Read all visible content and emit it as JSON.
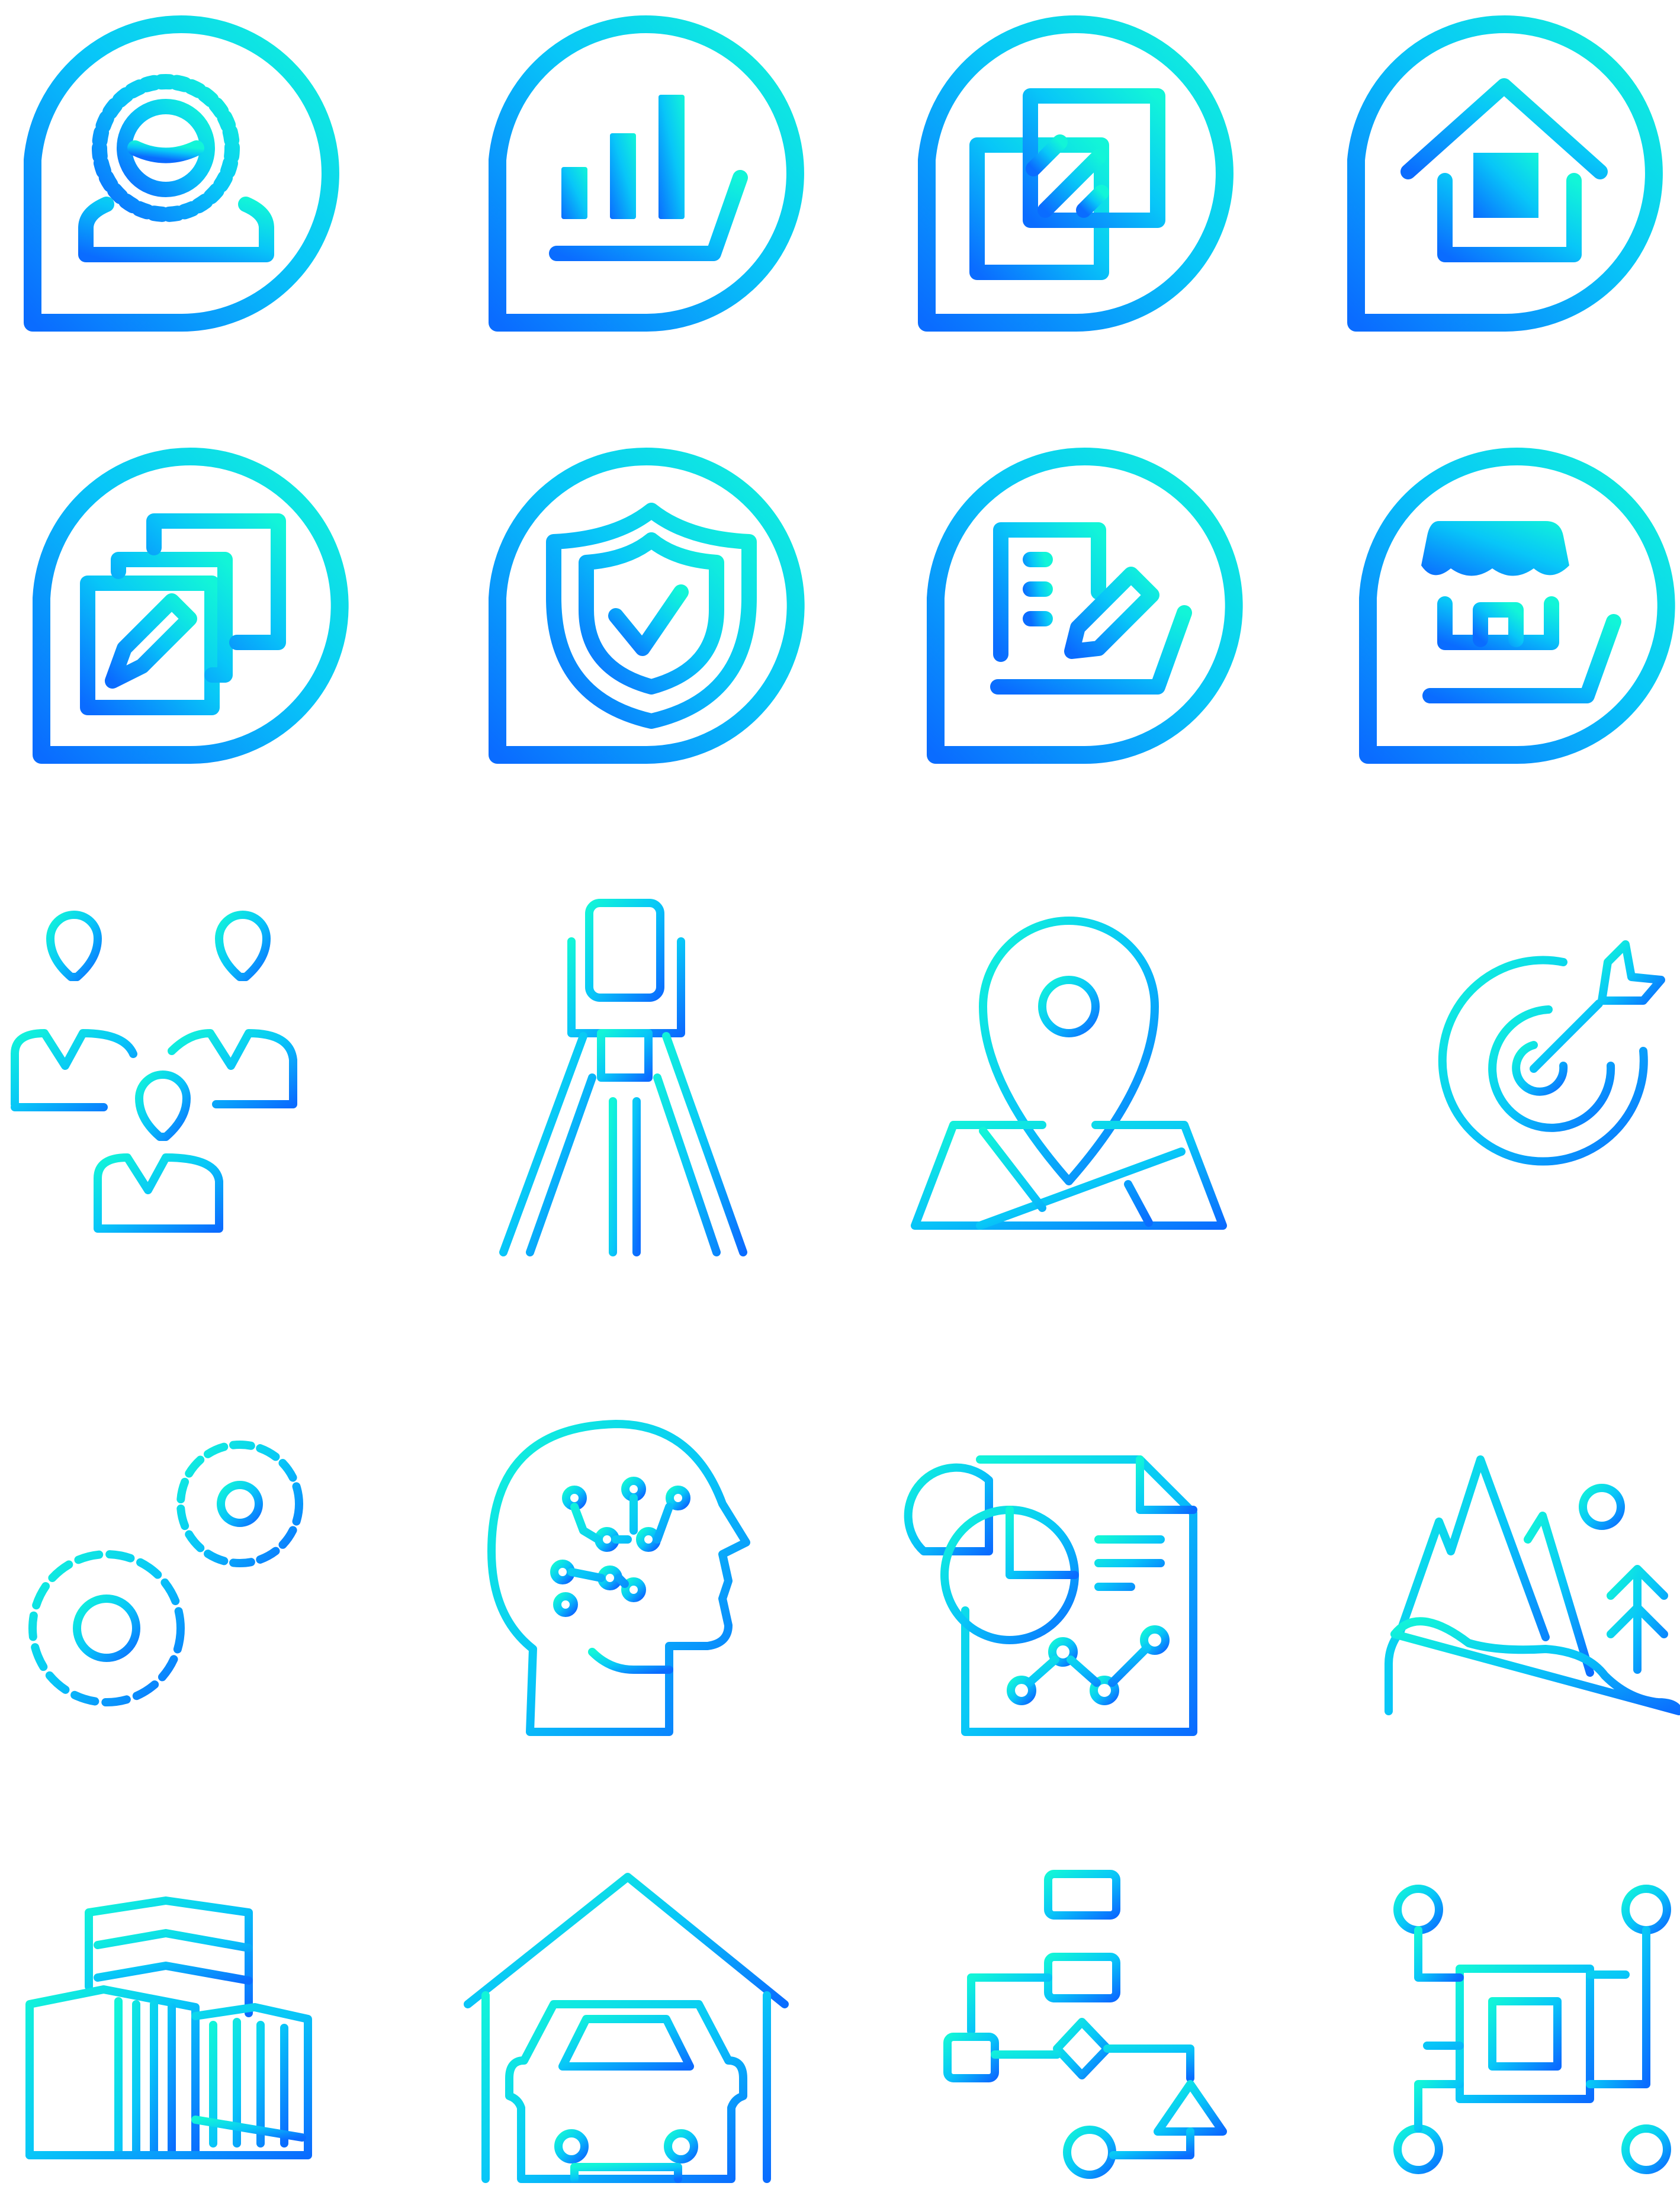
{
  "palette": {
    "gradient_start": "#12F5D8",
    "gradient_mid": "#08C6F8",
    "gradient_end": "#0A6CFF"
  },
  "icons": [
    {
      "name": "customer-profile-icon"
    },
    {
      "name": "growth-chart-icon"
    },
    {
      "name": "design-documents-icon"
    },
    {
      "name": "home-real-estate-icon"
    },
    {
      "name": "edit-files-icon"
    },
    {
      "name": "security-shield-icon"
    },
    {
      "name": "blueprint-edit-icon"
    },
    {
      "name": "storefront-icon"
    },
    {
      "name": "team-people-icon"
    },
    {
      "name": "surveying-tripod-icon"
    },
    {
      "name": "map-location-pin-icon"
    },
    {
      "name": "target-goal-icon"
    },
    {
      "name": "gears-settings-icon"
    },
    {
      "name": "artificial-intelligence-head-icon"
    },
    {
      "name": "data-report-icon"
    },
    {
      "name": "landscape-mountains-icon"
    },
    {
      "name": "city-buildings-icon"
    },
    {
      "name": "garage-car-icon"
    },
    {
      "name": "flowchart-icon"
    },
    {
      "name": "processor-chip-network-icon"
    }
  ]
}
